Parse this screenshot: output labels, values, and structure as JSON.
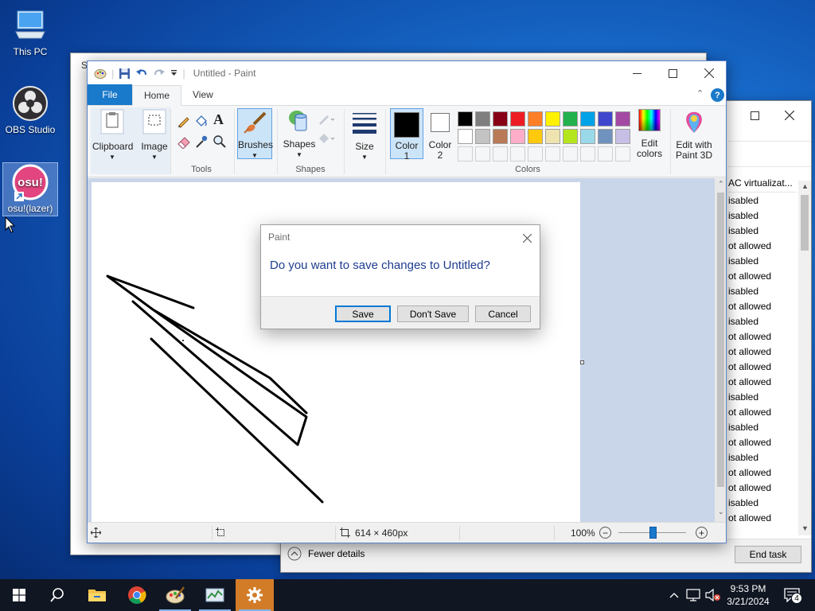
{
  "desktop": {
    "icons": [
      {
        "label": "This PC"
      },
      {
        "label": "OBS Studio"
      },
      {
        "label": "osu!(lazer)"
      }
    ]
  },
  "back_window": {
    "title_fragment": "S"
  },
  "paint": {
    "title": "Untitled - Paint",
    "tabs": {
      "file": "File",
      "home": "Home",
      "view": "View"
    },
    "ribbon": {
      "clipboard": "Clipboard",
      "image": "Image",
      "tools_group": "Tools",
      "brushes": "Brushes",
      "shapes_btn": "Shapes",
      "shapes_group": "Shapes",
      "size": "Size",
      "color1_line1": "Color",
      "color1_line2": "1",
      "color2_line1": "Color",
      "color2_line2": "2",
      "edit_colors_line1": "Edit",
      "edit_colors_line2": "colors",
      "edit_3d_line1": "Edit with",
      "edit_3d_line2": "Paint 3D",
      "colors_group": "Colors",
      "palette_row1": [
        "#000000",
        "#7f7f7f",
        "#880015",
        "#ed1c24",
        "#ff7f27",
        "#fff200",
        "#22b14c",
        "#00a2e8",
        "#3f48cc",
        "#a349a4"
      ],
      "palette_row2": [
        "#ffffff",
        "#c3c3c3",
        "#b97a57",
        "#ffaec9",
        "#ffc90e",
        "#efe4b0",
        "#b5e61d",
        "#99d9ea",
        "#7092be",
        "#c8bfe7"
      ]
    },
    "status": {
      "canvas_size": "614 × 460px",
      "zoom": "100%"
    }
  },
  "dialog": {
    "title": "Paint",
    "message": "Do you want to save changes to Untitled?",
    "save": "Save",
    "dont_save": "Don't Save",
    "cancel": "Cancel"
  },
  "task_manager": {
    "column_header": "AC virtualizat...",
    "rows": [
      "isabled",
      "isabled",
      "isabled",
      "ot allowed",
      "isabled",
      "ot allowed",
      "isabled",
      "ot allowed",
      "isabled",
      "ot allowed",
      "ot allowed",
      "ot allowed",
      "ot allowed",
      "isabled",
      "ot allowed",
      "isabled",
      "ot allowed",
      "isabled",
      "ot allowed",
      "ot allowed",
      "isabled",
      "ot allowed"
    ],
    "fewer_details": "Fewer details",
    "end_task": "End task"
  },
  "taskbar": {
    "time": "9:53 PM",
    "date": "3/21/2024",
    "notifications": "4"
  }
}
